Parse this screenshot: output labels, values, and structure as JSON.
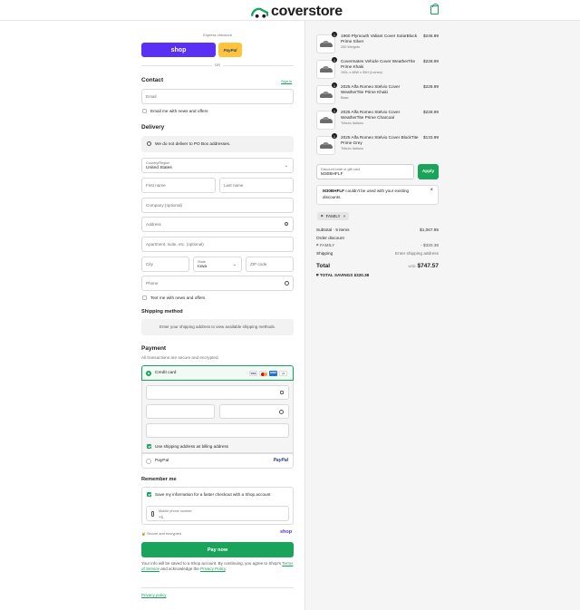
{
  "header": {
    "brand": "coverstore",
    "accent": "#1aa35a"
  },
  "express": {
    "label": "Express checkout",
    "shop": "shop",
    "paypal": "PayPal",
    "or": "OR"
  },
  "contact": {
    "title": "Contact",
    "sign_in": "Sign in",
    "email_placeholder": "Email",
    "news_label": "Email me with news and offers"
  },
  "delivery": {
    "title": "Delivery",
    "notice": "We do not deliver to PO Box addresses.",
    "country_label": "Country/Region",
    "country_value": "United States",
    "first_name": "First name",
    "last_name": "Last name",
    "company": "Company (optional)",
    "address": "Address",
    "apartment": "Apartment, suite, etc. (optional)",
    "city": "City",
    "state_label": "State",
    "state_value": "Iowa",
    "zip": "ZIP code",
    "phone": "Phone",
    "text_label": "Text me with news and offers"
  },
  "shipping": {
    "title": "Shipping method",
    "notice": "Enter your shipping address to view available shipping methods."
  },
  "payment": {
    "title": "Payment",
    "subtitle": "All transactions are secure and encrypted.",
    "credit_card": "Credit card",
    "more_cards": "+5",
    "billing_label": "Use shipping address as billing address",
    "paypal": "PayPal"
  },
  "remember": {
    "title": "Remember me",
    "save_label": "Save my information for a faster checkout with a Shop account",
    "phone_label": "Mobile phone number",
    "phone_value": "+1",
    "secure": "Secure and encrypted",
    "shop": "shop"
  },
  "pay_now": "Pay now",
  "legal": {
    "text1": "Your info will be saved to a Shop account. By continuing, you agree to Shop's",
    "terms": "Terms of Service",
    "text2": "and acknowledge the",
    "privacy": "Privacy Policy",
    "end": "."
  },
  "privacy_policy": "Privacy policy",
  "cart": {
    "items": [
      {
        "qty": "1",
        "name": "1960 Plymouth Valiant Cover SolarBlock Prime Silver",
        "sub": "250 Weignts",
        "price": "$246.99"
      },
      {
        "qty": "1",
        "name": "Covermates Vehicle Cover WeatherTite Prime Khaki",
        "sub": "190L x 68W x 55H (Inches)",
        "price": "$228.99"
      },
      {
        "qty": "1",
        "name": "2025 Alfa Romeo Stelvio Cover WeatherTite Prime Khaki",
        "sub": "Base",
        "price": "$228.99"
      },
      {
        "qty": "1",
        "name": "2025 Alfa Romeo Stelvio Cover WeatherTite Prime Charcoal",
        "sub": "Tributo Italiano",
        "price": "$228.99"
      },
      {
        "qty": "1",
        "name": "2025 Alfa Romeo Stelvio Cover BlockTite Prime Grey",
        "sub": "Tributo Italiano",
        "price": "$133.99"
      }
    ],
    "discount_label": "Discount code or gift card",
    "discount_value": "M30BHFLF",
    "apply": "Apply",
    "error_code": "M30BHFLF",
    "error_text": "couldn't be used with your existing discounts.",
    "tag": "FAMILY",
    "subtotal_label": "Subtotal · 5 items",
    "subtotal": "$1,067.95",
    "order_discount": "Order discount",
    "family": "FAMILY",
    "discount_amount": "- $320.38",
    "shipping_label": "Shipping",
    "shipping_value": "Enter shipping address",
    "total_label": "Total",
    "currency": "USD",
    "total": "$747.57",
    "savings_label": "TOTAL SAVINGS",
    "savings": "$320.38"
  }
}
